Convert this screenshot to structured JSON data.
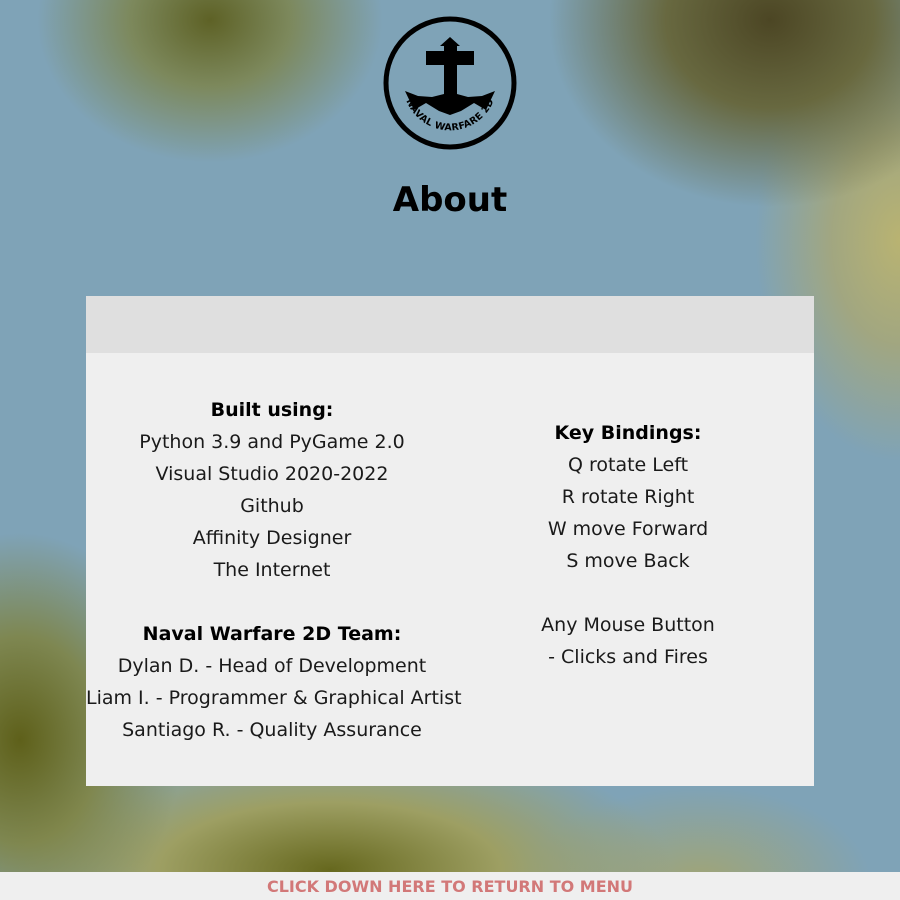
{
  "logo": {
    "text": "NAVAL WARFARE 2D",
    "icon": "anchor-icon"
  },
  "page": {
    "title": "About"
  },
  "built_using": {
    "heading": "Built using:",
    "items": [
      "Python 3.9 and PyGame 2.0",
      "Visual Studio 2020-2022",
      "Github",
      "Affinity Designer",
      "The Internet"
    ]
  },
  "team": {
    "heading": "Naval Warfare 2D Team:",
    "members": [
      "Dylan D. - Head of Development",
      "Liam I. - Programmer & Graphical Artist",
      "Santiago R. - Quality Assurance"
    ]
  },
  "key_bindings": {
    "heading": "Key Bindings:",
    "items": [
      "Q rotate Left",
      "R rotate Right",
      "W move Forward",
      "S move Back"
    ],
    "mouse_lines": [
      "Any Mouse Button",
      "- Clicks and Fires"
    ]
  },
  "footer": {
    "return_label": "CLICK DOWN HERE TO RETURN TO MENU"
  },
  "colors": {
    "panel": "#efefef",
    "panel_header": "#dfdfdf",
    "footer_text": "#d27878",
    "water": "#7fa3b7"
  }
}
